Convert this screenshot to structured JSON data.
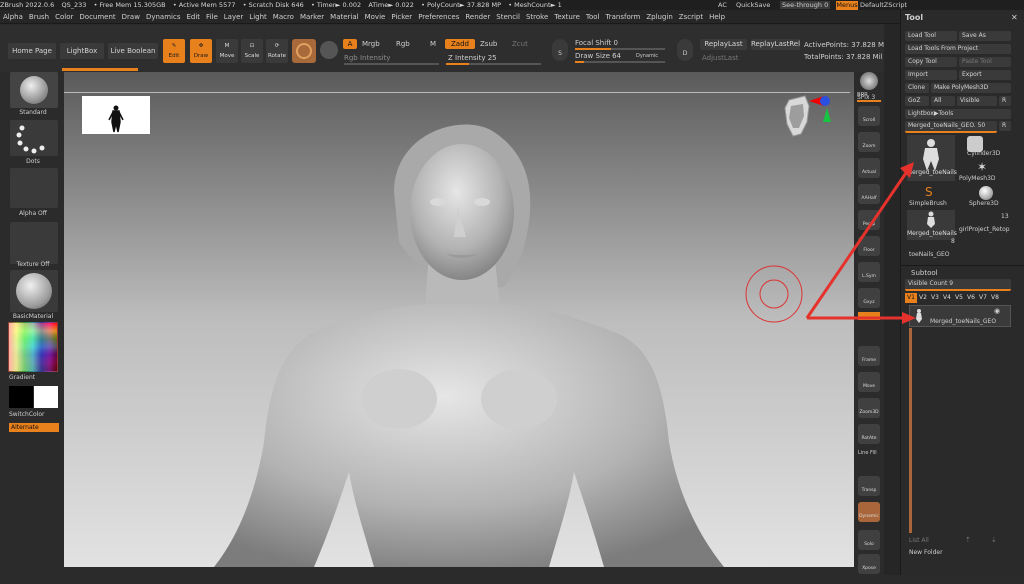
{
  "titlebar": {
    "app": "ZBrush 2022.0.6",
    "file": "QS_233",
    "free_mem": "• Free Mem 15.305GB",
    "active_mem": "• Active Mem 5577",
    "scratch": "• Scratch Disk 646",
    "timer": "• Timer► 0.002",
    "atime": "ATime► 0.022",
    "polycount": "• PolyCount► 37.828 MP",
    "meshcount": "• MeshCount► 1",
    "ac": "AC",
    "quicksave": "QuickSave",
    "seethrough": "See-through  0",
    "menus": "Menus",
    "script": "DefaultZScript"
  },
  "menu": [
    "Alpha",
    "Brush",
    "Color",
    "Document",
    "Draw",
    "Dynamics",
    "Edit",
    "File",
    "Layer",
    "Light",
    "Macro",
    "Marker",
    "Material",
    "Movie",
    "Picker",
    "Preferences",
    "Render",
    "Stencil",
    "Stroke",
    "Texture",
    "Tool",
    "Transform",
    "Zplugin",
    "Zscript",
    "Help"
  ],
  "shelf": {
    "home": "Home Page",
    "lightbox": "LightBox",
    "liveboolean": "Live Boolean",
    "edit": "Edit",
    "draw": "Draw",
    "move": "Move",
    "scale": "Scale",
    "rotate": "Rotate",
    "a": "A",
    "mrgb": "Mrgb",
    "rgb": "Rgb",
    "m": "M",
    "zadd": "Zadd",
    "zsub": "Zsub",
    "zcut": "Zcut",
    "rgb_intensity": "Rgb Intensity",
    "z_intensity": "Z Intensity 25",
    "s_label": "S",
    "focal_shift": "Focal Shift 0",
    "draw_size": "Draw Size 64",
    "dynamic": "Dynamic",
    "d_label": "D",
    "replaylast": "ReplayLast",
    "replaylastrel": "ReplayLastRel",
    "adjustlast": "AdjustLast",
    "activepoints": "ActivePoints: 37.828 Mil",
    "totalpoints": "TotalPoints: 37.828 Mil"
  },
  "left": {
    "standard": "Standard",
    "dots": "Dots",
    "alpha_off": "Alpha Off",
    "texture_off": "Texture Off",
    "basic_material": "BasicMaterial",
    "gradient": "Gradient",
    "switchcolor": "SwitchColor",
    "alternate": "Alternate"
  },
  "right": {
    "bpr": "BPR",
    "spix": "SPix 3",
    "scroll": "Scroll",
    "zoom": "Zoom",
    "actual": "Actual",
    "aahalf": "AAHalf",
    "persp": "Persp",
    "floor": "Floor",
    "lsym": "L.Sym",
    "gxyz": "Gxyz",
    "frame": "Frame",
    "move": "Move",
    "zoom3d": "Zoom3D",
    "rotate": "RotAte",
    "linefill": "Line Fill",
    "transp": "Transp",
    "dynamic": "Dynamic",
    "solo": "Solo",
    "xpose": "Xpose"
  },
  "tool": {
    "title": "Tool",
    "load_tool": "Load Tool",
    "save_as": "Save As",
    "load_from_project": "Load Tools From Project",
    "copy_tool": "Copy Tool",
    "paste_tool": "Paste Tool",
    "import": "Import",
    "export": "Export",
    "clone": "Clone",
    "make_polymesh": "Make PolyMesh3D",
    "goz": "GoZ",
    "all": "All",
    "visible": "Visible",
    "r": "R",
    "lightbox_tools": "Lightbox▶Tools",
    "current_tool": "Merged_toeNails_GEO. 50",
    "r2": "R",
    "thumb1": "Merged_toeNails",
    "thumb2": "Cylinder3D",
    "thumb3": "PolyMesh3D",
    "thumb4": "SimpleBrush",
    "thumb5": "Sphere3D",
    "thumb6": "Merged_toeNails",
    "thumb7": "girlProject_Retop",
    "thumb7_count": "13",
    "thumb8_count": "8",
    "toenails": "toeNails_GEO",
    "subtool": "Subtool",
    "visible_count": "Visible Count 9",
    "vtabs": [
      "V1",
      "V2",
      "V3",
      "V4",
      "V5",
      "V6",
      "V7",
      "V8"
    ],
    "subtool_name": "Merged_toeNails_GEO",
    "list_all": "List All",
    "new_folder": "New Folder"
  }
}
